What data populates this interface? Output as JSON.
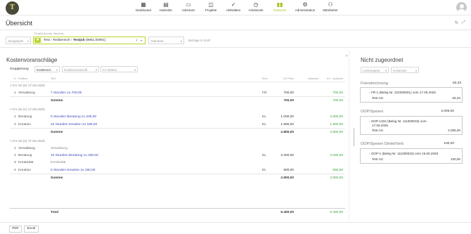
{
  "nav": {
    "logo": "T",
    "items": [
      {
        "label": "Dashboard",
        "icon": "▦"
      },
      {
        "label": "Kalender",
        "icon": "▤"
      },
      {
        "label": "Adressen",
        "icon": "▭"
      },
      {
        "label": "Projekte",
        "icon": "◫"
      },
      {
        "label": "Aktivitäten",
        "icon": "✓"
      },
      {
        "label": "Arbeitszeit",
        "icon": "◷"
      },
      {
        "label": "Finanzen",
        "icon": "▮▮"
      },
      {
        "label": "Administration",
        "icon": "⚙"
      },
      {
        "label": "Mitarbeiter",
        "icon": "⚇"
      }
    ]
  },
  "title": "Übersicht",
  "titlebar_icons": {
    "refresh": "↻",
    "expand": "⤢",
    "settings": "⚙"
  },
  "filters": {
    "budget_placeholder": "Budgetjahr",
    "project_label": "Projekt (Kunde, Bereich)",
    "crumb_1": "Test",
    "crumb_2": "Testbereich",
    "crumb_3": "Testjob",
    "crumb_3_id": "(9951.00901)",
    "sep": "›",
    "mandant_placeholder": "Mandant",
    "currency_note": "Beträge in EUR",
    "caret": "▾",
    "clear": "×"
  },
  "main": {
    "title": "Kostenvoranschläge",
    "grouping_label": "Gruppierung",
    "grouping_value": "Kostenvor.",
    "grouping_2": "Kostenvoranschl.",
    "grouping_3": "KV-Status",
    "collapse_arrow": "›",
    "headers": {
      "pos": "#",
      "position": "Position",
      "text": "Text",
      "unit": "Einh.",
      "kv_price": "KV Preis",
      "effort": "Aufwand",
      "remaining": "KV - Aufwand"
    },
    "groups": [
      {
        "title": "KV-10 (2) 17.06.2025",
        "rows": [
          {
            "pos": "1",
            "position": "Verwaltung",
            "text": "7 Stunden zu 700,00",
            "unit": "FR",
            "price": "700,00",
            "remaining": "700,00"
          }
        ],
        "sum_label": "Summe",
        "sum_price": "700,00",
        "sum_remaining": "700,00"
      },
      {
        "title": "KV-15 (1) 17.06.2025",
        "rows": [
          {
            "pos": "1",
            "position": "Beratung",
            "text": "5 Stunden Beratung zu 200,00",
            "unit": "EL",
            "price": "1.000,00",
            "remaining": "2.000,00"
          },
          {
            "pos": "2",
            "position": "Kreation",
            "text": "10 Stunden Kreation zu 180,00",
            "unit": "EL",
            "price": "1.800,00",
            "remaining": "1.800,00"
          }
        ],
        "sum_label": "Summe",
        "sum_price": "2.800,00",
        "sum_remaining": "2.800,00"
      },
      {
        "title": "KV-16 (4) 17.06.2025",
        "rows": [
          {
            "pos": "1",
            "position": "Verwaltung",
            "text": "Verwaltung",
            "unit": "",
            "price": "",
            "remaining": ""
          },
          {
            "pos": "2",
            "position": "Beratung",
            "text": "10 Stunden Beratung zu 200,00",
            "unit": "EL",
            "price": "2.000,00",
            "remaining": "2.000,00"
          },
          {
            "pos": "3",
            "position": "Kreativität",
            "text": "Kreativität",
            "unit": "",
            "price": "",
            "remaining": ""
          },
          {
            "pos": "4",
            "position": "Kreation",
            "text": "5 Stunden Kreation zu 180,00",
            "unit": "EL",
            "price": "900,00",
            "remaining": "900,00"
          }
        ],
        "sum_label": "Summe",
        "sum_price": "2.900,00",
        "sum_remaining": "2.900,00"
      }
    ],
    "total_label": "Total",
    "total_price": "6.400,00",
    "total_remaining": "6.400,00"
  },
  "right": {
    "title": "Nicht zugeordnet",
    "filter_1": "Leistungsart",
    "filter_2": "Kostenart",
    "sections": [
      {
        "title": "Fremdrechnung",
        "amount": "83,33",
        "entry_1": "FR-1 (Beleg Nr. 222250001) vom 17.06.2025",
        "entry_2": "Test AG",
        "entry_amount": "83,33"
      },
      {
        "title": "OOP/Spesen",
        "amount": "2.005,00",
        "entry_1": "OOP-1334 (Beleg Nr. 111000033) vom",
        "entry_1b": "17.06.2025",
        "entry_2": "Test AG",
        "entry_amount": "2.005,00"
      },
      {
        "title": "OOP/Spesen Direkt/Verb",
        "amount": "100,00",
        "entry_1": "OOP-1 (Beleg Nr. 111000032) vom 16.06.2025",
        "entry_2": "Test AG",
        "entry_amount": "100,00"
      }
    ]
  },
  "footer": {
    "pdf": "PDF",
    "excel": "Excel"
  }
}
